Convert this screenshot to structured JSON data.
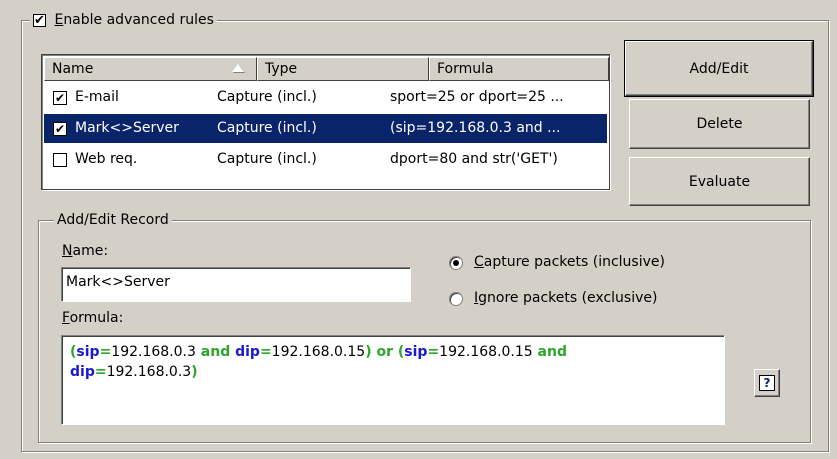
{
  "enable_checkbox": {
    "label": "Enable advanced rules",
    "accel": "E",
    "rest": "nable advanced rules",
    "checked": true
  },
  "list": {
    "headers": [
      "Name",
      "Type",
      "Formula"
    ],
    "rows": [
      {
        "checked": true,
        "name": "E-mail",
        "type": "Capture (incl.)",
        "formula": "sport=25 or dport=25 ...",
        "selected": false
      },
      {
        "checked": true,
        "name": "Mark<>Server",
        "type": "Capture (incl.)",
        "formula": "(sip=192.168.0.3 and ...",
        "selected": true
      },
      {
        "checked": false,
        "name": "Web req.",
        "type": "Capture (incl.)",
        "formula": "dport=80 and str('GET')",
        "selected": false
      }
    ]
  },
  "buttons": {
    "add_edit": "Add/Edit",
    "delete": "Delete",
    "evaluate": "Evaluate"
  },
  "record": {
    "group_title": "Add/Edit Record",
    "name_label": "Name:",
    "name_label_accel": "N",
    "name_label_rest": "ame:",
    "name_value": "Mark<>Server",
    "formula_label_accel": "F",
    "formula_label_rest": "ormula:",
    "radio_capture": {
      "accel": "C",
      "rest": "apture packets (inclusive)",
      "selected": true
    },
    "radio_ignore": {
      "accel": "I",
      "rest": "gnore packets (exclusive)",
      "selected": false
    },
    "formula_tokens_line1": [
      {
        "t": "(",
        "c": "kw-paren"
      },
      {
        "t": "sip",
        "c": "kw-field"
      },
      {
        "t": "=",
        "c": "kw-op"
      },
      {
        "t": "192.168.0.3",
        "c": "kw-val"
      },
      {
        "t": " and ",
        "c": "kw-and"
      },
      {
        "t": "dip",
        "c": "kw-field"
      },
      {
        "t": "=",
        "c": "kw-op"
      },
      {
        "t": "192.168.0.15",
        "c": "kw-val"
      },
      {
        "t": ")",
        "c": "kw-paren"
      },
      {
        "t": " or ",
        "c": "kw-and"
      },
      {
        "t": "(",
        "c": "kw-paren"
      },
      {
        "t": "sip",
        "c": "kw-field"
      },
      {
        "t": "=",
        "c": "kw-op"
      },
      {
        "t": "192.168.0.15",
        "c": "kw-val"
      },
      {
        "t": " and",
        "c": "kw-and"
      }
    ],
    "formula_tokens_line2": [
      {
        "t": "dip",
        "c": "kw-field"
      },
      {
        "t": "=",
        "c": "kw-op"
      },
      {
        "t": "192.168.0.3",
        "c": "kw-val"
      },
      {
        "t": ")",
        "c": "kw-paren"
      }
    ],
    "help_icon": "help-question-icon"
  },
  "colors": {
    "selection": "#0a246a",
    "dialog_bg": "#d4d0c8",
    "keyword_green": "#2ea52e",
    "field_blue": "#1a1ad2"
  }
}
